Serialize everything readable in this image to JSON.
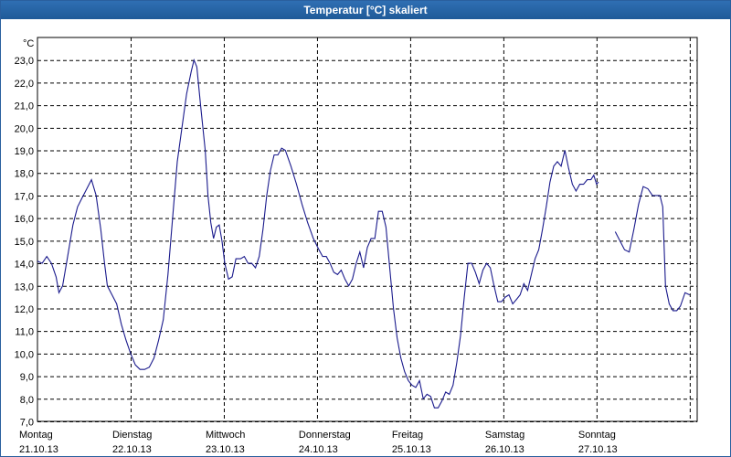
{
  "window": {
    "title": "Temperatur [°C] skaliert"
  },
  "chart_data": {
    "type": "line",
    "title": "Temperatur [°C] skaliert",
    "ylabel": "°C",
    "xlabel": "",
    "ylim": [
      7.0,
      24.0
    ],
    "xlim": [
      0,
      7.08
    ],
    "grid": true,
    "y_ticks": [
      "7,0",
      "8,0",
      "9,0",
      "10,0",
      "11,0",
      "12,0",
      "13,0",
      "14,0",
      "15,0",
      "16,0",
      "17,0",
      "18,0",
      "19,0",
      "20,0",
      "21,0",
      "22,0",
      "23,0"
    ],
    "x_ticks": [
      {
        "day": "Montag",
        "date": "21.10.13"
      },
      {
        "day": "Dienstag",
        "date": "22.10.13"
      },
      {
        "day": "Mittwoch",
        "date": "23.10.13"
      },
      {
        "day": "Donnerstag",
        "date": "24.10.13"
      },
      {
        "day": "Freitag",
        "date": "25.10.13"
      },
      {
        "day": "Samstag",
        "date": "26.10.13"
      },
      {
        "day": "Sonntag",
        "date": "27.10.13"
      }
    ],
    "series": [
      {
        "color": "#1a1a8c",
        "segments": [
          [
            [
              0.0,
              14.1
            ],
            [
              0.05,
              14.0
            ],
            [
              0.1,
              14.3
            ],
            [
              0.15,
              14.0
            ],
            [
              0.2,
              13.4
            ],
            [
              0.23,
              12.7
            ],
            [
              0.27,
              13.0
            ],
            [
              0.32,
              14.2
            ],
            [
              0.38,
              15.7
            ],
            [
              0.43,
              16.5
            ],
            [
              0.48,
              16.9
            ],
            [
              0.53,
              17.3
            ],
            [
              0.58,
              17.7
            ],
            [
              0.63,
              17.0
            ],
            [
              0.68,
              15.5
            ],
            [
              0.72,
              14.0
            ],
            [
              0.75,
              13.0
            ],
            [
              0.8,
              12.6
            ],
            [
              0.85,
              12.2
            ],
            [
              0.9,
              11.3
            ],
            [
              0.95,
              10.6
            ],
            [
              1.0,
              10.0
            ],
            [
              1.05,
              9.5
            ],
            [
              1.1,
              9.3
            ],
            [
              1.15,
              9.3
            ],
            [
              1.2,
              9.4
            ],
            [
              1.25,
              9.8
            ],
            [
              1.3,
              10.6
            ],
            [
              1.35,
              11.5
            ],
            [
              1.4,
              13.5
            ],
            [
              1.45,
              16.0
            ],
            [
              1.5,
              18.5
            ],
            [
              1.55,
              20.0
            ],
            [
              1.6,
              21.5
            ],
            [
              1.65,
              22.5
            ],
            [
              1.68,
              23.0
            ],
            [
              1.71,
              22.7
            ],
            [
              1.75,
              21.0
            ],
            [
              1.8,
              19.0
            ],
            [
              1.83,
              17.0
            ],
            [
              1.86,
              15.8
            ],
            [
              1.89,
              15.1
            ],
            [
              1.92,
              15.6
            ],
            [
              1.95,
              15.7
            ],
            [
              1.98,
              15.0
            ],
            [
              2.01,
              14.0
            ],
            [
              2.05,
              13.3
            ],
            [
              2.09,
              13.4
            ],
            [
              2.13,
              14.2
            ],
            [
              2.18,
              14.2
            ],
            [
              2.22,
              14.3
            ],
            [
              2.26,
              14.0
            ],
            [
              2.3,
              14.0
            ],
            [
              2.34,
              13.8
            ],
            [
              2.38,
              14.3
            ],
            [
              2.42,
              15.5
            ],
            [
              2.46,
              17.0
            ],
            [
              2.5,
              18.1
            ],
            [
              2.54,
              18.8
            ],
            [
              2.58,
              18.8
            ],
            [
              2.62,
              19.1
            ],
            [
              2.66,
              19.0
            ],
            [
              2.72,
              18.3
            ],
            [
              2.78,
              17.5
            ],
            [
              2.84,
              16.6
            ],
            [
              2.9,
              15.8
            ],
            [
              2.96,
              15.1
            ],
            [
              3.02,
              14.6
            ],
            [
              3.06,
              14.3
            ],
            [
              3.1,
              14.3
            ],
            [
              3.14,
              14.0
            ],
            [
              3.18,
              13.6
            ],
            [
              3.22,
              13.5
            ],
            [
              3.26,
              13.7
            ],
            [
              3.3,
              13.3
            ],
            [
              3.34,
              13.0
            ],
            [
              3.38,
              13.3
            ],
            [
              3.42,
              14.0
            ],
            [
              3.46,
              14.5
            ],
            [
              3.5,
              13.8
            ],
            [
              3.54,
              14.7
            ],
            [
              3.58,
              15.1
            ],
            [
              3.62,
              15.1
            ],
            [
              3.66,
              16.3
            ],
            [
              3.7,
              16.3
            ],
            [
              3.74,
              15.6
            ],
            [
              3.78,
              13.8
            ],
            [
              3.82,
              12.0
            ],
            [
              3.86,
              10.7
            ],
            [
              3.9,
              9.8
            ],
            [
              3.94,
              9.2
            ],
            [
              3.98,
              8.8
            ],
            [
              4.02,
              8.6
            ],
            [
              4.06,
              8.5
            ],
            [
              4.1,
              8.8
            ],
            [
              4.14,
              8.0
            ],
            [
              4.18,
              8.2
            ],
            [
              4.22,
              8.1
            ],
            [
              4.26,
              7.6
            ],
            [
              4.3,
              7.6
            ],
            [
              4.34,
              7.9
            ],
            [
              4.38,
              8.3
            ],
            [
              4.42,
              8.2
            ],
            [
              4.46,
              8.6
            ],
            [
              4.5,
              9.6
            ],
            [
              4.54,
              10.8
            ],
            [
              4.58,
              12.5
            ],
            [
              4.62,
              14.0
            ],
            [
              4.66,
              14.0
            ],
            [
              4.7,
              13.6
            ],
            [
              4.74,
              13.1
            ],
            [
              4.78,
              13.7
            ],
            [
              4.82,
              14.0
            ],
            [
              4.86,
              13.8
            ],
            [
              4.9,
              13.0
            ],
            [
              4.94,
              12.3
            ],
            [
              4.98,
              12.3
            ],
            [
              5.02,
              12.5
            ],
            [
              5.06,
              12.6
            ],
            [
              5.1,
              12.2
            ],
            [
              5.14,
              12.4
            ],
            [
              5.18,
              12.6
            ],
            [
              5.22,
              13.1
            ],
            [
              5.26,
              12.8
            ],
            [
              5.3,
              13.5
            ],
            [
              5.34,
              14.2
            ],
            [
              5.38,
              14.6
            ],
            [
              5.42,
              15.5
            ],
            [
              5.46,
              16.5
            ],
            [
              5.5,
              17.6
            ],
            [
              5.54,
              18.3
            ],
            [
              5.58,
              18.5
            ],
            [
              5.62,
              18.3
            ],
            [
              5.66,
              19.0
            ],
            [
              5.7,
              18.2
            ],
            [
              5.74,
              17.5
            ],
            [
              5.78,
              17.2
            ],
            [
              5.82,
              17.5
            ],
            [
              5.86,
              17.5
            ],
            [
              5.9,
              17.7
            ],
            [
              5.94,
              17.7
            ],
            [
              5.97,
              17.9
            ],
            [
              6.0,
              17.5
            ],
            [
              6.02,
              17.6
            ]
          ],
          [
            [
              6.2,
              15.4
            ],
            [
              6.25,
              15.0
            ],
            [
              6.3,
              14.6
            ],
            [
              6.35,
              14.5
            ],
            [
              6.4,
              15.5
            ],
            [
              6.45,
              16.6
            ],
            [
              6.5,
              17.4
            ],
            [
              6.55,
              17.3
            ],
            [
              6.6,
              17.0
            ],
            [
              6.65,
              17.0
            ],
            [
              6.68,
              17.0
            ],
            [
              6.71,
              16.5
            ],
            [
              6.74,
              13.0
            ],
            [
              6.78,
              12.2
            ],
            [
              6.82,
              11.9
            ],
            [
              6.86,
              11.9
            ],
            [
              6.9,
              12.1
            ],
            [
              6.95,
              12.7
            ],
            [
              7.0,
              12.6
            ]
          ]
        ]
      }
    ]
  }
}
